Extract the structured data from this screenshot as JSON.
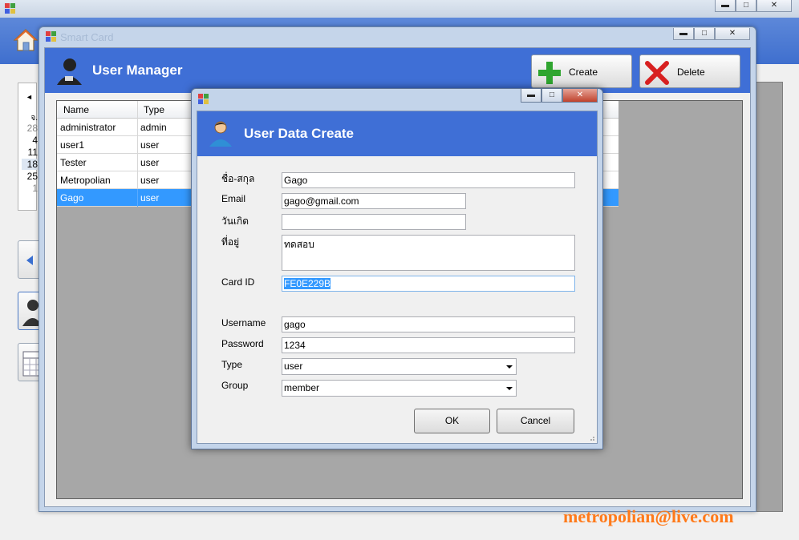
{
  "main_window": {
    "calendar": {
      "nav_prev": "◄",
      "day_header": "จ.",
      "days": [
        "28",
        "4",
        "11",
        "18",
        "25",
        "1"
      ]
    }
  },
  "user_manager": {
    "title": "User Manager",
    "window_title": "Smart Card",
    "create_label": "Create",
    "delete_label": "Delete",
    "columns": [
      "Name",
      "Type"
    ],
    "rows": [
      {
        "name": "administrator",
        "type": "admin"
      },
      {
        "name": "user1",
        "type": "user"
      },
      {
        "name": "Tester",
        "type": "user"
      },
      {
        "name": "Metropolian",
        "type": "user"
      },
      {
        "name": "Gago",
        "type": "user"
      }
    ],
    "selected_row": 4
  },
  "dialog": {
    "title": "User Data Create",
    "labels": {
      "fullname": "ชื่อ-สกุล",
      "email": "Email",
      "birthday": "วันเกิด",
      "address": "ที่อยู่",
      "card_id": "Card ID",
      "username": "Username",
      "password": "Password",
      "type": "Type",
      "group": "Group"
    },
    "values": {
      "fullname": "Gago",
      "email": "gago@gmail.com",
      "birthday": "",
      "address": "ทดสอบ",
      "card_id": "FE0E229B",
      "username": "gago",
      "password": "1234",
      "type": "user",
      "group": "member"
    },
    "ok_label": "OK",
    "cancel_label": "Cancel",
    "window_controls": {
      "minimize": "▬",
      "maximize": "□",
      "close": "✕"
    }
  },
  "watermark": "metropolian@live.com",
  "colors": {
    "header_blue": "#3f6fd6",
    "selection_blue": "#3399ff",
    "watermark_orange": "#ff7a1a"
  },
  "icons": [
    "app-icon",
    "home-icon",
    "user-icon",
    "create-plus-icon",
    "delete-x-icon",
    "calendar-icon"
  ]
}
